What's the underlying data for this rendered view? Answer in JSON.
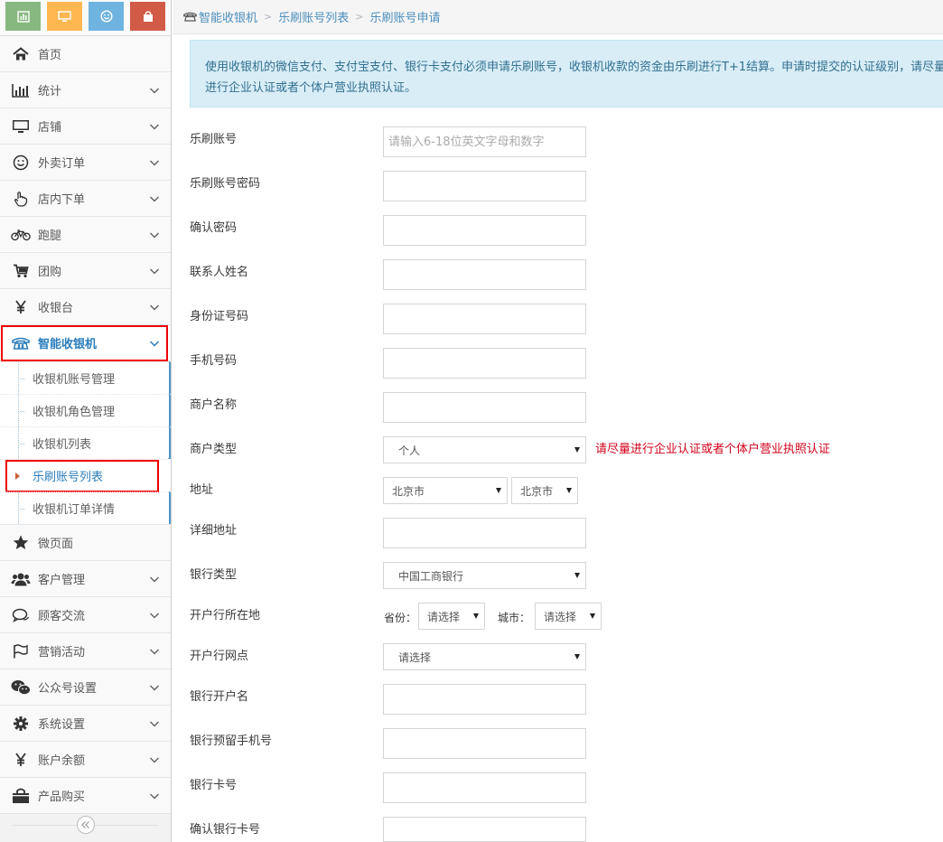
{
  "breadcrumb": [
    "智能收银机",
    "乐刷账号列表",
    "乐刷账号申请"
  ],
  "shortcut_icons": [
    "chart-icon",
    "desktop-icon",
    "smile-icon",
    "bag-icon"
  ],
  "nav": [
    {
      "label": "首页",
      "icon": "home-icon"
    },
    {
      "label": "统计",
      "icon": "bar-chart-icon"
    },
    {
      "label": "店铺",
      "icon": "desktop-icon"
    },
    {
      "label": "外卖订单",
      "icon": "smile-icon"
    },
    {
      "label": "店内下单",
      "icon": "hand-pointer-icon"
    },
    {
      "label": "跑腿",
      "icon": "bicycle-icon"
    },
    {
      "label": "团购",
      "icon": "cart-icon"
    },
    {
      "label": "收银台",
      "icon": "yen-icon"
    },
    {
      "label": "智能收银机",
      "icon": "phone-icon"
    }
  ],
  "submenu": [
    "收银机账号管理",
    "收银机角色管理",
    "收银机列表",
    "乐刷账号列表",
    "收银机订单详情"
  ],
  "nav_after": [
    {
      "label": "微页面",
      "icon": "star-icon"
    },
    {
      "label": "客户管理",
      "icon": "users-icon"
    },
    {
      "label": "顾客交流",
      "icon": "comments-icon"
    },
    {
      "label": "营销活动",
      "icon": "flag-icon"
    },
    {
      "label": "公众号设置",
      "icon": "wechat-icon"
    },
    {
      "label": "系统设置",
      "icon": "gear-icon"
    },
    {
      "label": "账户余额",
      "icon": "yen-icon"
    },
    {
      "label": "产品购买",
      "icon": "shopping-bag-icon"
    }
  ],
  "alert": "使用收银机的微信支付、支付宝支付、银行卡支付必须申请乐刷账号，收银机收款的资金由乐刷进行T+1结算。申请时提交的认证级别，请尽量进行企业认证或者个体户营业执照认证。",
  "form": {
    "account_label": "乐刷账号",
    "account_placeholder": "请输入6-18位英文字母和数字",
    "password_label": "乐刷账号密码",
    "confirm_password_label": "确认密码",
    "contact_label": "联系人姓名",
    "id_label": "身份证号码",
    "phone_label": "手机号码",
    "merchant_name_label": "商户名称",
    "merchant_type_label": "商户类型",
    "merchant_type_value": "个人",
    "merchant_type_hint": "请尽量进行企业认证或者个体户营业执照认证",
    "address_label": "地址",
    "province_value": "北京市",
    "city_value": "北京市",
    "detail_address_label": "详细地址",
    "bank_type_label": "银行类型",
    "bank_type_value": "中国工商银行",
    "bank_location_label": "开户行所在地",
    "bank_province_label": "省份：",
    "bank_province_value": "请选择",
    "bank_city_label": "城市：",
    "bank_city_value": "请选择",
    "bank_branch_label": "开户行网点",
    "bank_branch_value": "请选择",
    "account_holder_label": "银行开户名",
    "bank_phone_label": "银行预留手机号",
    "card_no_label": "银行卡号",
    "confirm_card_label": "确认银行卡号"
  },
  "colors": {
    "accent": "#2b7dbc",
    "highlight_red": "#e00000",
    "alert_bg": "#d9edf7"
  }
}
